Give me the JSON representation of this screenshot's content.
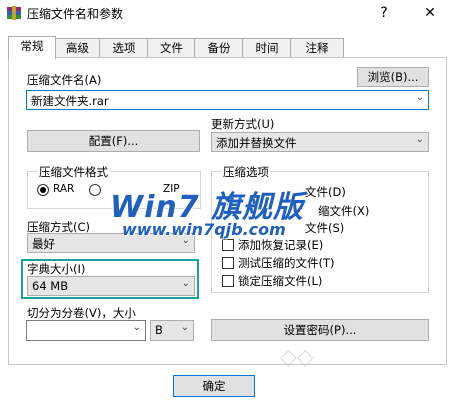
{
  "window": {
    "title": "压缩文件名和参数",
    "help": "?",
    "close": "✕"
  },
  "tabs": [
    "常规",
    "高级",
    "选项",
    "文件",
    "备份",
    "时间",
    "注释"
  ],
  "archive_name": {
    "label": "压缩文件名(A)",
    "browse": "浏览(B)...",
    "value": "新建文件夹.rar"
  },
  "profiles_button": "配置(F)...",
  "update_mode": {
    "label": "更新方式(U)",
    "value": "添加并替换文件"
  },
  "archive_format": {
    "label": "压缩文件格式",
    "options": [
      "RAR",
      "RAR5",
      "ZIP"
    ],
    "selected": "RAR"
  },
  "archive_options": {
    "label": "压缩选项",
    "items": [
      "压缩后删除原来的文件(D)",
      "创建自解压格式压缩文件(X)",
      "创建固实压缩文件(S)",
      "添加恢复记录(E)",
      "测试压缩的文件(T)",
      "锁定压缩文件(L)"
    ],
    "visible_fragments": [
      "文件(D)",
      "缩文件(X)",
      "文件(S)"
    ]
  },
  "compression_method": {
    "label": "压缩方式(C)",
    "value": "最好"
  },
  "dictionary_size": {
    "label": "字典大小(I)",
    "value": "64 MB"
  },
  "split_volumes": {
    "label": "切分为分卷(V)，大小",
    "value": "",
    "unit": "B"
  },
  "set_password": "设置密码(P)...",
  "ok_button": "确定",
  "watermark": {
    "line1": "Win7 旗舰版",
    "line2": "www.win7qjb.com"
  },
  "colors": {
    "highlight": "#1aa39a",
    "focus": "#0078d7",
    "watermark": "#1f5fbf"
  }
}
